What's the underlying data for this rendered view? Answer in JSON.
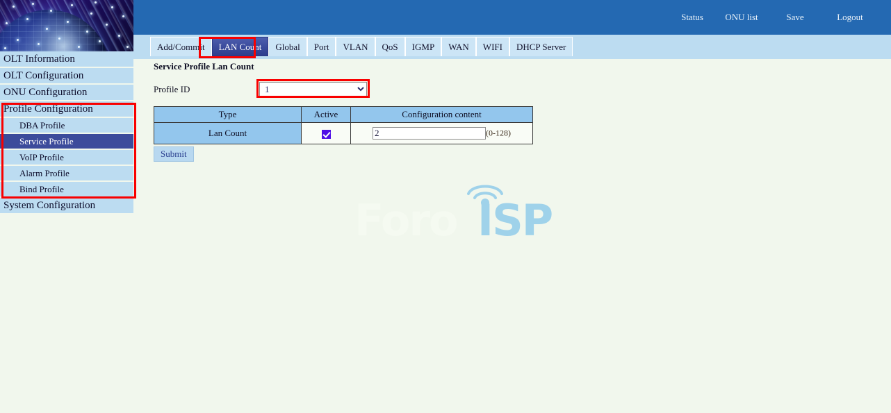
{
  "header": {
    "banner_alt": "globe-fiber-optic-banner",
    "nav": [
      {
        "label": "Status",
        "name": "nav-status"
      },
      {
        "label": "ONU list",
        "name": "nav-onulist"
      },
      {
        "label": "Save",
        "name": "nav-save"
      },
      {
        "label": "Logout",
        "name": "nav-logout"
      }
    ],
    "bar_color": "#2469b2"
  },
  "sidebar": {
    "items": [
      {
        "label": "OLT Information",
        "level": "top",
        "selected": false
      },
      {
        "label": "OLT Configuration",
        "level": "top",
        "selected": false
      },
      {
        "label": "ONU Configuration",
        "level": "top",
        "selected": false
      },
      {
        "label": "Profile Configuration",
        "level": "top",
        "selected": false
      },
      {
        "label": "DBA Profile",
        "level": "sub",
        "selected": false
      },
      {
        "label": "Service Profile",
        "level": "sub",
        "selected": true
      },
      {
        "label": "VoIP Profile",
        "level": "sub",
        "selected": false
      },
      {
        "label": "Alarm Profile",
        "level": "sub",
        "selected": false
      },
      {
        "label": "Bind Profile",
        "level": "sub",
        "selected": false
      },
      {
        "label": "System Configuration",
        "level": "top",
        "selected": false
      }
    ],
    "selected_color": "#3c4b9b",
    "item_color": "#bcdcf1"
  },
  "tabs": {
    "items": [
      {
        "label": "Add/Commit",
        "active": false
      },
      {
        "label": "LAN Count",
        "active": true
      },
      {
        "label": "Global",
        "active": false
      },
      {
        "label": "Port",
        "active": false
      },
      {
        "label": "VLAN",
        "active": false
      },
      {
        "label": "QoS",
        "active": false
      },
      {
        "label": "IGMP",
        "active": false
      },
      {
        "label": "WAN",
        "active": false
      },
      {
        "label": "WIFI",
        "active": false
      },
      {
        "label": "DHCP Server",
        "active": false
      }
    ],
    "bar_color": "#bcdcf1",
    "active_color": "#3a4a9c"
  },
  "main": {
    "title": "Service Profile Lan Count",
    "profile_id_label": "Profile ID",
    "profile_id_value": "1",
    "profile_id_options": [
      "1"
    ],
    "table": {
      "headers": [
        "Type",
        "Active",
        "Configuration content"
      ],
      "rows": [
        {
          "type": "Lan Count",
          "active_checked": true,
          "value": "2",
          "range_hint": "(0-128)"
        }
      ]
    },
    "submit_label": "Submit"
  },
  "watermark": {
    "text_light": "Foro",
    "text_accent": "ISP",
    "accent_color": "#9fd2ea",
    "light_color": "#f5faf1"
  },
  "annotations": {
    "highlight_color": "#f90000",
    "boxes": [
      "sidebar-profile-configuration",
      "tab-lan-count",
      "profile-id-select"
    ]
  }
}
